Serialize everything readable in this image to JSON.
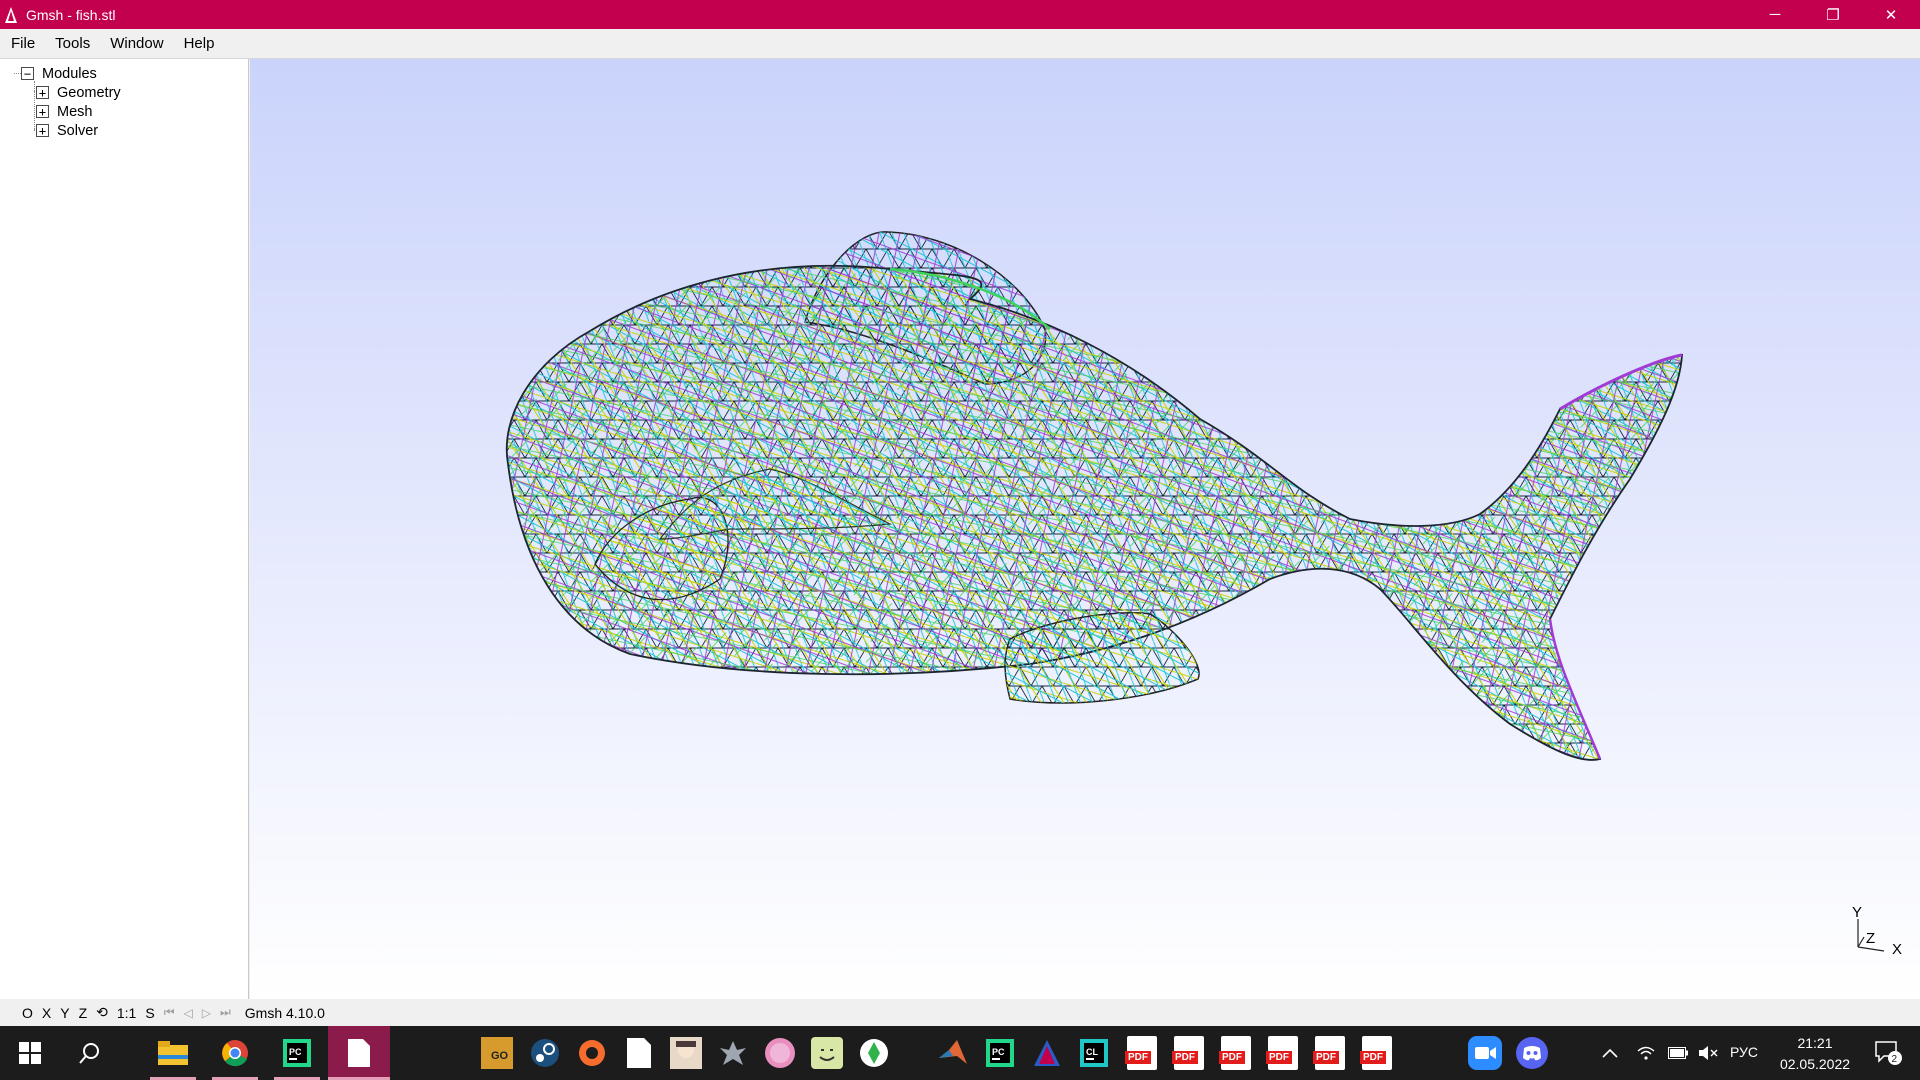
{
  "window": {
    "title": "Gmsh - fish.stl",
    "controls": {
      "minimize": "─",
      "maximize": "❐",
      "close": "✕"
    }
  },
  "menubar": {
    "items": [
      "File",
      "Tools",
      "Window",
      "Help"
    ]
  },
  "tree": {
    "root": {
      "label": "Modules",
      "toggle": "−"
    },
    "children": [
      {
        "label": "Geometry",
        "toggle": "+"
      },
      {
        "label": "Mesh",
        "toggle": "+"
      },
      {
        "label": "Solver",
        "toggle": "+"
      }
    ]
  },
  "viewport": {
    "model": "fish.stl",
    "background_top": "#cad3fb",
    "background_bottom": "#ffffff",
    "axes": {
      "y": "Y",
      "z": "Z",
      "x": "X"
    }
  },
  "statusbar": {
    "buttons": [
      "O",
      "X",
      "Y",
      "Z",
      "⟲",
      "1:1",
      "S"
    ],
    "playback_icons": [
      "first-icon",
      "previous-icon",
      "play-icon",
      "last-icon"
    ],
    "version": "Gmsh 4.10.0"
  },
  "taskbar": {
    "language": "РУС",
    "time": "21:21",
    "date": "02.05.2022",
    "notification_count": "2",
    "pdf_label": "PDF"
  },
  "colors": {
    "titlebar": "#c2004d",
    "taskbar": "#1c1c1c"
  }
}
